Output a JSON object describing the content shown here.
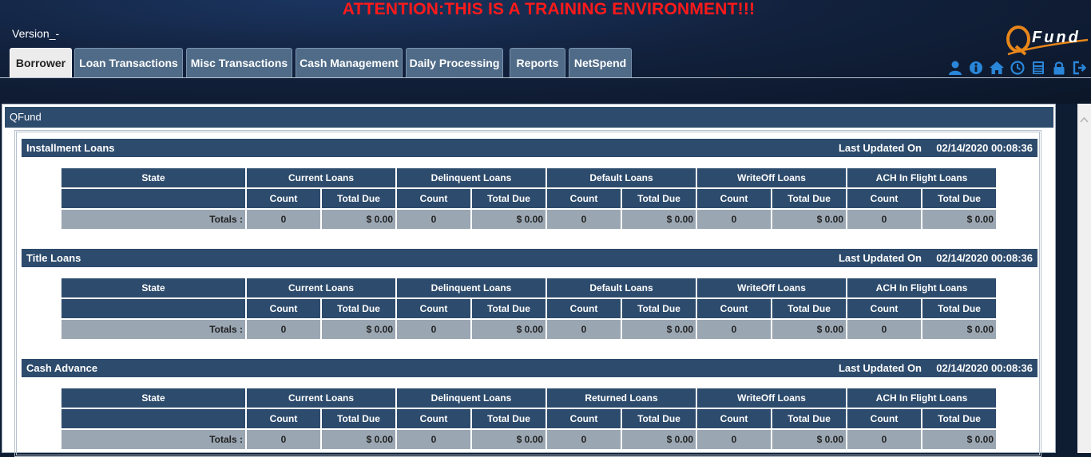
{
  "header": {
    "attention": "ATTENTION:THIS IS A TRAINING ENVIRONMENT!!!",
    "version": "Version_-",
    "logo_text": "Fund"
  },
  "tabs": [
    {
      "label": "Borrower",
      "active": true
    },
    {
      "label": "Loan Transactions",
      "active": false
    },
    {
      "label": "Misc Transactions",
      "active": false
    },
    {
      "label": "Cash Management",
      "active": false
    },
    {
      "label": "Daily Processing",
      "active": false
    },
    {
      "label": "Reports",
      "active": false
    },
    {
      "label": "NetSpend",
      "active": false
    }
  ],
  "header_icons": [
    "user-icon",
    "info-icon",
    "home-icon",
    "clock-icon",
    "calculator-icon",
    "lock-icon",
    "logout-icon"
  ],
  "panel": {
    "title": "QFund"
  },
  "labels": {
    "last_updated": "Last Updated On",
    "state": "State",
    "count": "Count",
    "total_due": "Total Due",
    "totals": "Totals :"
  },
  "sections": [
    {
      "title": "Installment Loans",
      "last_updated": "02/14/2020 00:08:36",
      "groups": [
        "Current Loans",
        "Delinquent Loans",
        "Default Loans",
        "WriteOff Loans",
        "ACH In Flight Loans"
      ],
      "totals": [
        {
          "count": "0",
          "total": "$ 0.00"
        },
        {
          "count": "0",
          "total": "$ 0.00"
        },
        {
          "count": "0",
          "total": "$ 0.00"
        },
        {
          "count": "0",
          "total": "$ 0.00"
        },
        {
          "count": "0",
          "total": "$ 0.00"
        }
      ]
    },
    {
      "title": "Title Loans",
      "last_updated": "02/14/2020 00:08:36",
      "groups": [
        "Current Loans",
        "Delinquent Loans",
        "Default Loans",
        "WriteOff Loans",
        "ACH In Flight Loans"
      ],
      "totals": [
        {
          "count": "0",
          "total": "$ 0.00"
        },
        {
          "count": "0",
          "total": "$ 0.00"
        },
        {
          "count": "0",
          "total": "$ 0.00"
        },
        {
          "count": "0",
          "total": "$ 0.00"
        },
        {
          "count": "0",
          "total": "$ 0.00"
        }
      ]
    },
    {
      "title": "Cash Advance",
      "last_updated": "02/14/2020 00:08:36",
      "groups": [
        "Current Loans",
        "Delinquent Loans",
        "Returned Loans",
        "WriteOff Loans",
        "ACH In Flight Loans"
      ],
      "totals": [
        {
          "count": "0",
          "total": "$ 0.00"
        },
        {
          "count": "0",
          "total": "$ 0.00"
        },
        {
          "count": "0",
          "total": "$ 0.00"
        },
        {
          "count": "0",
          "total": "$ 0.00"
        },
        {
          "count": "0",
          "total": "$ 0.00"
        }
      ]
    }
  ],
  "colors": {
    "attention": "#ff1a1a",
    "bar": "#2d4b6c",
    "tab": "#4f6b88",
    "totals_row": "#9aa6b2",
    "icon": "#2a86d8"
  }
}
